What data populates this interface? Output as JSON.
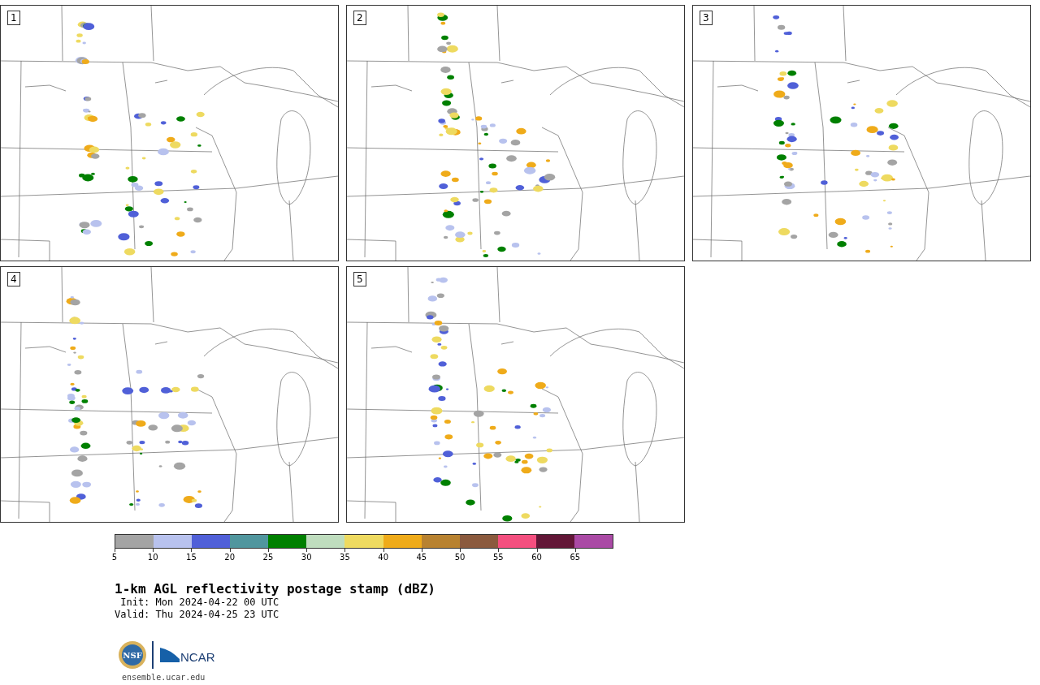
{
  "panels": [
    {
      "label": "1"
    },
    {
      "label": "2"
    },
    {
      "label": "3"
    },
    {
      "label": "4"
    },
    {
      "label": "5"
    }
  ],
  "colorbar": {
    "bins": [
      {
        "label": "5",
        "color": "#a4a4a4"
      },
      {
        "label": "10",
        "color": "#b8c2ee"
      },
      {
        "label": "15",
        "color": "#5060d8"
      },
      {
        "label": "20",
        "color": "#50969e"
      },
      {
        "label": "25",
        "color": "#008000"
      },
      {
        "label": "30",
        "color": "#bfddbe"
      },
      {
        "label": "35",
        "color": "#eeda60"
      },
      {
        "label": "40",
        "color": "#efab1a"
      },
      {
        "label": "45",
        "color": "#b88230"
      },
      {
        "label": "50",
        "color": "#8b5a3e"
      },
      {
        "label": "55",
        "color": "#f44f7f"
      },
      {
        "label": "60",
        "color": "#621737"
      },
      {
        "label": "65",
        "color": "#aa4aa5"
      }
    ]
  },
  "title": "1-km AGL reflectivity postage stamp (dBZ)",
  "init": " Init: Mon 2024-04-22 00 UTC",
  "valid": "Valid: Thu 2024-04-25 23 UTC",
  "logos": {
    "nsf": "NSF",
    "ncar": "NCAR"
  },
  "url": "ensemble.ucar.edu"
}
